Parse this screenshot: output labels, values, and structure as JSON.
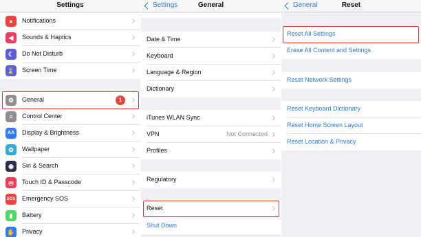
{
  "panel1": {
    "title": "Settings",
    "items": [
      {
        "label": "Notifications",
        "icon": "notifications-icon",
        "color": "#f2413f",
        "glyph": "●"
      },
      {
        "label": "Sounds & Haptics",
        "icon": "speaker-icon",
        "color": "#f23a60",
        "glyph": "◀"
      },
      {
        "label": "Do Not Disturb",
        "icon": "moon-icon",
        "color": "#5b5ed6",
        "glyph": "☾"
      },
      {
        "label": "Screen Time",
        "icon": "hourglass-icon",
        "color": "#5b5ed6",
        "glyph": "⌛"
      },
      {
        "label": "General",
        "icon": "gear-icon",
        "color": "#8e8e93",
        "glyph": "⚙",
        "badge": "1"
      },
      {
        "label": "Control Center",
        "icon": "toggles-icon",
        "color": "#8e8e93",
        "glyph": "≡"
      },
      {
        "label": "Display & Brightness",
        "icon": "text-size-icon",
        "color": "#2f7cf6",
        "glyph": "AA"
      },
      {
        "label": "Wallpaper",
        "icon": "flower-icon",
        "color": "#34aadc",
        "glyph": "✿"
      },
      {
        "label": "Siri & Search",
        "icon": "siri-icon",
        "color": "#2b2b4a",
        "glyph": "◉"
      },
      {
        "label": "Touch ID & Passcode",
        "icon": "fingerprint-icon",
        "color": "#f23a53",
        "glyph": "◎"
      },
      {
        "label": "Emergency SOS",
        "icon": "sos-icon",
        "color": "#f2413f",
        "glyph": "SOS"
      },
      {
        "label": "Battery",
        "icon": "battery-icon",
        "color": "#4cd964",
        "glyph": "▮"
      },
      {
        "label": "Privacy",
        "icon": "hand-icon",
        "color": "#2f7cf6",
        "glyph": "✋"
      }
    ]
  },
  "panel2": {
    "back": "Settings",
    "title": "General",
    "items": [
      {
        "label": "Date & Time"
      },
      {
        "label": "Keyboard"
      },
      {
        "label": "Language & Region"
      },
      {
        "label": "Dictionary"
      },
      {
        "label": "iTunes WLAN Sync"
      },
      {
        "label": "VPN",
        "value": "Not Connected"
      },
      {
        "label": "Profiles"
      },
      {
        "label": "Regulatory"
      },
      {
        "label": "Reset"
      },
      {
        "label": "Shut Down"
      }
    ]
  },
  "panel3": {
    "back": "General",
    "title": "Reset",
    "items": [
      {
        "label": "Reset All Settings"
      },
      {
        "label": "Erase All Content and Settings"
      },
      {
        "label": "Reset Network Settings"
      },
      {
        "label": "Reset Keyboard Dictionary"
      },
      {
        "label": "Reset Home Screen Layout"
      },
      {
        "label": "Reset Location & Privacy"
      }
    ]
  },
  "colors": {
    "link": "#2a7ae2",
    "highlight": "#e2372f",
    "badge": "#e8423c"
  }
}
